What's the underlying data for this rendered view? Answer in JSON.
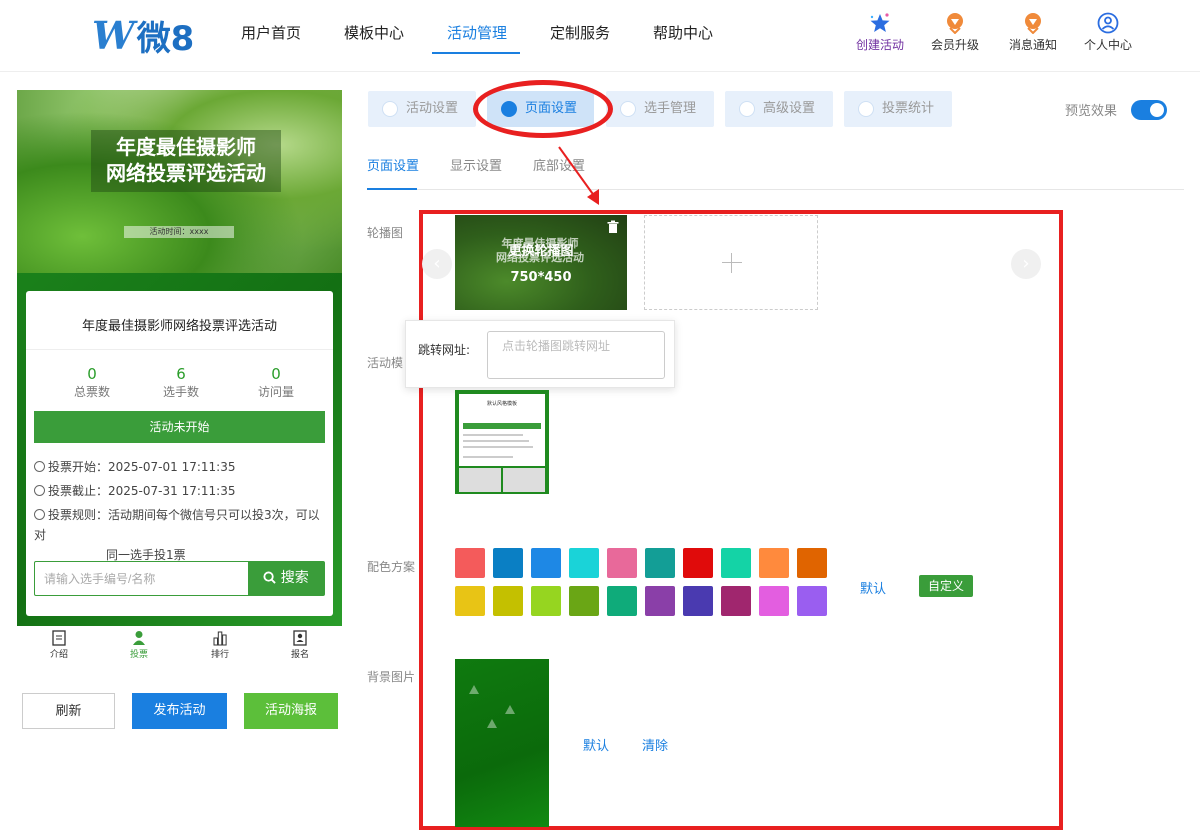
{
  "brand": {
    "logo_w": "W",
    "logo_text": "微8"
  },
  "nav": {
    "items": [
      "用户首页",
      "模板中心",
      "活动管理",
      "定制服务",
      "帮助中心"
    ],
    "active": "活动管理"
  },
  "toolbar": {
    "create": "创建活动",
    "member": "会员升级",
    "message": "消息通知",
    "profile": "个人中心"
  },
  "preview": {
    "banner_title_line1": "年度最佳摄影师",
    "banner_title_line2": "网络投票评选活动",
    "banner_time": "活动时间：xxxx",
    "card_title": "年度最佳摄影师网络投票评选活动",
    "stats": [
      {
        "value": "0",
        "label": "总票数"
      },
      {
        "value": "6",
        "label": "选手数"
      },
      {
        "value": "0",
        "label": "访问量"
      }
    ],
    "status_button": "活动未开始",
    "vote_start_label": "投票开始：",
    "vote_start": "2025-07-01 17:11:35",
    "vote_end_label": "投票截止：",
    "vote_end": "2025-07-31 17:11:35",
    "rules_label": "投票规则：",
    "rules_line1": "活动期间每个微信号只可以投3次，可以对",
    "rules_line2": "同一选手投1票",
    "search_placeholder": "请输入选手编号/名称",
    "search_button": "搜索",
    "tabbar": [
      "介绍",
      "投票",
      "排行",
      "报名"
    ],
    "tabbar_active": "投票"
  },
  "actions": {
    "refresh": "刷新",
    "publish": "发布活动",
    "poster": "活动海报"
  },
  "settings_tabs": [
    "活动设置",
    "页面设置",
    "选手管理",
    "高级设置",
    "投票统计"
  ],
  "settings_active": "页面设置",
  "preview_toggle": {
    "label": "预览效果",
    "on": true
  },
  "sub_tabs": [
    "页面设置",
    "显示设置",
    "底部设置"
  ],
  "sub_active": "页面设置",
  "fields": {
    "carousel": "轮播图",
    "template": "活动模",
    "color_scheme": "配色方案",
    "background": "背景图片"
  },
  "carousel": {
    "slide_title_line1": "年度最佳摄影师",
    "slide_title_line2": "网络投票评选活动",
    "slide_overlay": "更换轮播图",
    "slide_size": "750*450",
    "link_label": "跳转网址:",
    "link_placeholder": "点击轮播图跳转网址"
  },
  "template_thumb_title": "默认风格模板",
  "colors": {
    "row1": [
      "#f45b5b",
      "#0a7fc4",
      "#1e88e5",
      "#1ad3d8",
      "#e8699a",
      "#139e96",
      "#e00b0b",
      "#14d3a6",
      "#ff8a3d",
      "#e06400"
    ],
    "row2": [
      "#e8c415",
      "#c4c000",
      "#96d520",
      "#6aa615",
      "#0fab7a",
      "#8a3fa8",
      "#4a3ab0",
      "#a0266e",
      "#e35ee0",
      "#9a5ef0"
    ],
    "default_button": "默认",
    "custom_button": "自定义"
  },
  "background": {
    "default_button": "默认",
    "clear_button": "清除"
  }
}
